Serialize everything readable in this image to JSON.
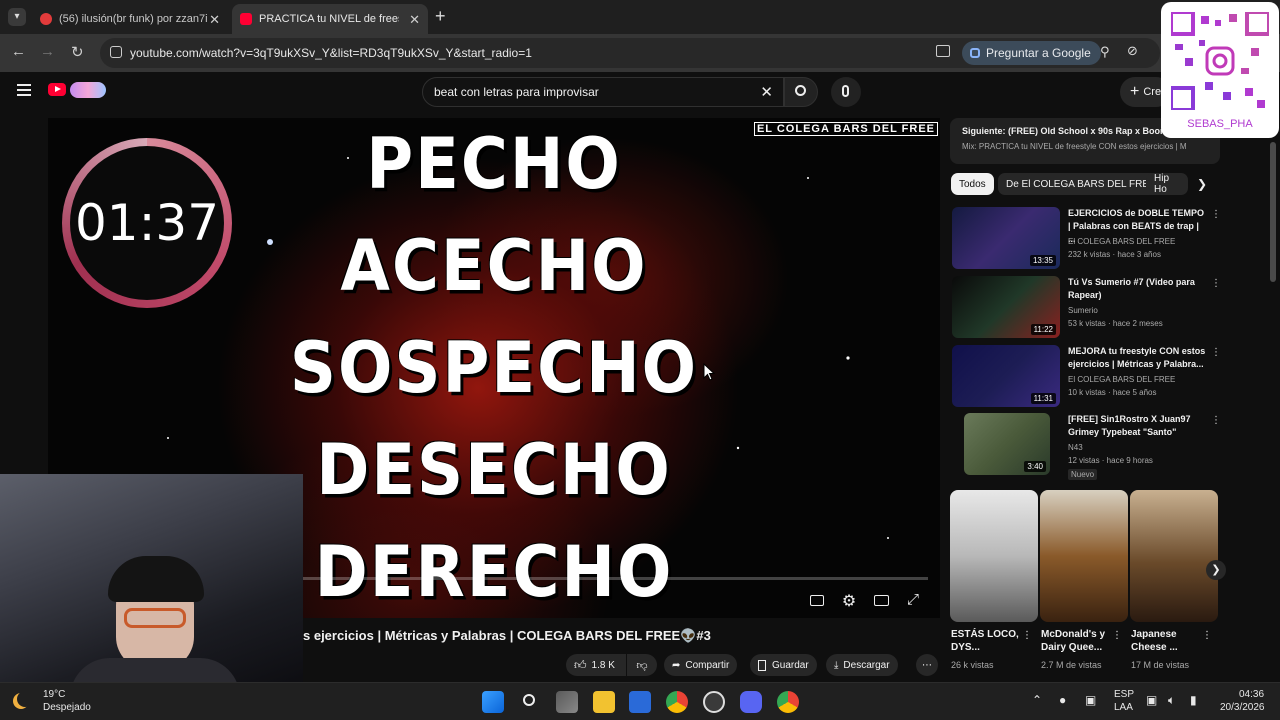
{
  "browser": {
    "tabs": [
      {
        "label": "(56) ilusión(br funk) por zzan7i",
        "active": false,
        "favicon_color": "#e23b3b"
      },
      {
        "label": "PRACTICA tu NIVEL de freestyle",
        "active": true,
        "favicon_color": "#ff0033"
      }
    ],
    "new_tab_label": "+",
    "url": "youtube.com/watch?v=3qT9ukXSv_Y&list=RD3qT9ukXSv_Y&start_radio=1",
    "ask_google_label": "Preguntar a Google"
  },
  "youtube": {
    "search_value": "beat con letras para improvisar",
    "create_label": "Cre",
    "video": {
      "words": [
        "PECHO",
        "ACECHO",
        "SOSPECHO",
        "DESECHO",
        "DERECHO"
      ],
      "watermark": "EL COLEGA BARS DEL FREE",
      "timer": "01:37",
      "progress_fraction": 0.12,
      "title": "s ejercicios | Métricas y Palabras | COLEGA BARS DEL FREE👽#3"
    },
    "actions": {
      "likes": "1.8 K",
      "share": "Compartir",
      "save": "Guardar",
      "download": "Descargar"
    },
    "up_next": {
      "title": "Siguiente: (FREE) Old School x 90s Rap x Boom",
      "subtitle": "Mix: PRACTICA tu NIVEL de freestyle CON estos ejercicios | M"
    },
    "chips": [
      "Todos",
      "De El COLEGA BARS DEL FREE",
      "Hip Ho"
    ],
    "related": [
      {
        "title": "EJERCICIOS de DOBLE TEMPO | Palabras con BEATS de trap | ...",
        "channel": "El COLEGA BARS DEL FREE",
        "meta": "232 k vistas · hace 3 años",
        "duration": "13:35",
        "thumb_color": "#1a2a5a",
        "badge": ""
      },
      {
        "title": "Tú Vs Sumerio #7 (Video para Rapear)",
        "channel": "Sumerio",
        "meta": "53 k vistas · hace 2 meses",
        "duration": "11:22",
        "thumb_color": "#203828",
        "badge": ""
      },
      {
        "title": "MEJORA tu freestyle CON estos ejercicios | Métricas y Palabra...",
        "channel": "El COLEGA BARS DEL FREE",
        "meta": "10 k vistas · hace 5 años",
        "duration": "11:31",
        "thumb_color": "#1d1d55",
        "badge": ""
      },
      {
        "title": "[FREE] Sin1Rostro X Juan97 Grimey Typebeat \"Santo\"",
        "channel": "N43",
        "meta": "12 vistas · hace 9 horas",
        "duration": "3:40",
        "thumb_color": "#4a5a3a",
        "badge": "Nuevo"
      }
    ],
    "shorts": [
      {
        "title": "ESTÁS LOCO, DYS...",
        "views": "26 k vistas",
        "color": "#c9c9c9"
      },
      {
        "title": "McDonald's y Dairy Quee...",
        "views": "2.7 M de vistas",
        "color": "#8a5a2a"
      },
      {
        "title": "Japanese Cheese ...",
        "views": "17 M de vistas",
        "color": "#6a4a2a"
      }
    ]
  },
  "qr_overlay": {
    "handle": "SEBAS_PHA"
  },
  "taskbar": {
    "weather_temp": "19°C",
    "weather_desc": "Despejado",
    "lang_top": "ESP",
    "lang_bottom": "LAA",
    "time": "04:36",
    "date": "20/3/2026"
  }
}
